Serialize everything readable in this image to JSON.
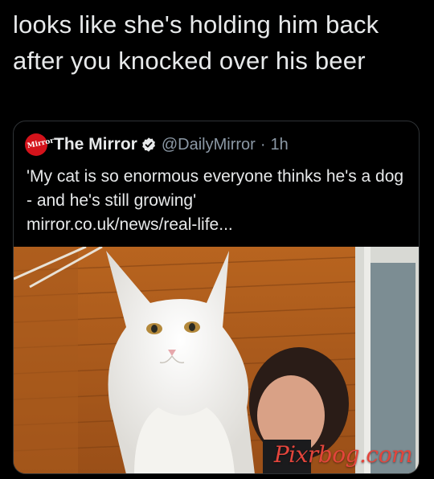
{
  "tweet": {
    "text": "looks like she's holding him back after you knocked over his beer"
  },
  "quote": {
    "avatar_text": "Mirror",
    "display_name": "The Mirror",
    "verified_icon": "verified-badge-icon",
    "handle": "@DailyMirror",
    "separator": "·",
    "time": "1h",
    "body": "'My cat is so enormous everyone thinks he's a dog - and he's still growing'",
    "link": "mirror.co.uk/news/real-life..."
  },
  "media": {
    "watermark": "Pixrbog.com"
  },
  "colors": {
    "background": "#000000",
    "text": "#e7e9ea",
    "muted": "#8b98a5",
    "verified": "#1d9bf0",
    "mirror_red": "#d4131b",
    "watermark": "#e4453c"
  }
}
